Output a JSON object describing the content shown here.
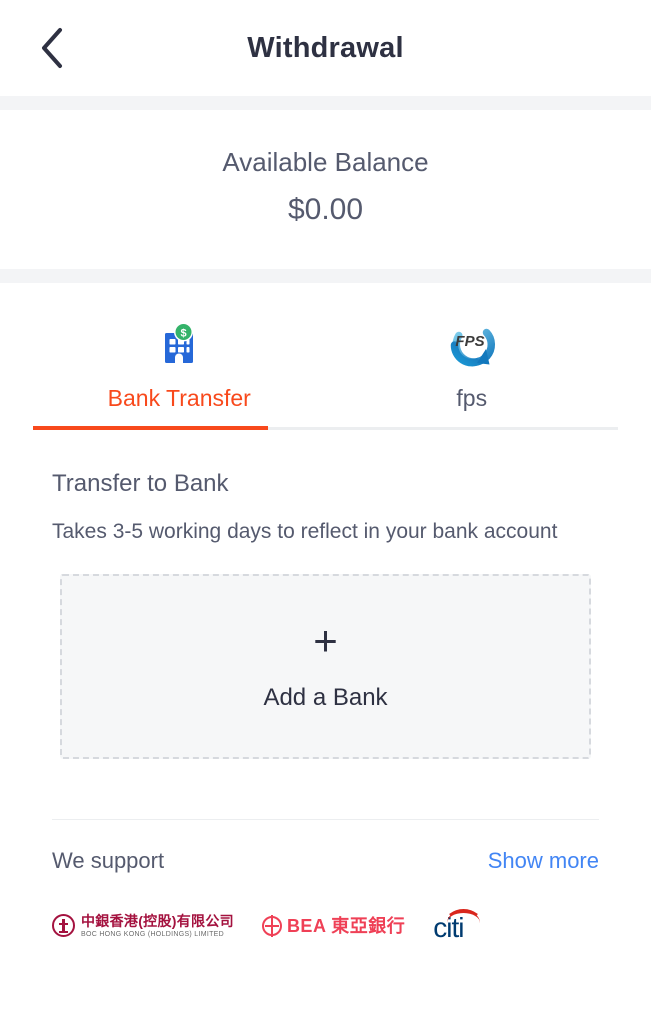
{
  "header": {
    "title": "Withdrawal",
    "back_icon": "chevron-left-icon"
  },
  "balance": {
    "label": "Available Balance",
    "amount": "$0.00"
  },
  "tabs": [
    {
      "label": "Bank Transfer",
      "icon": "bank-building-dollar-icon",
      "active": true
    },
    {
      "label": "fps",
      "icon": "fps-logo-icon",
      "active": false
    }
  ],
  "transfer": {
    "title": "Transfer to Bank",
    "subtitle": "Takes 3-5 working days to reflect in your bank account",
    "add_bank": {
      "plus": "+",
      "label": "Add a Bank",
      "icon": "plus-icon"
    }
  },
  "support": {
    "label": "We support",
    "show_more": "Show more",
    "banks": [
      {
        "name": "boc-hong-kong",
        "cn": "中銀香港(控股)有限公司",
        "en": "BOC HONG KONG (HOLDINGS) LIMITED"
      },
      {
        "name": "bea",
        "text": "BEA 東亞銀行"
      },
      {
        "name": "citi",
        "text": "citi"
      }
    ]
  },
  "colors": {
    "accent": "#f8491c",
    "link": "#4285f4",
    "text": "#555a6e",
    "title": "#2e3142",
    "band": "#f3f4f6"
  }
}
